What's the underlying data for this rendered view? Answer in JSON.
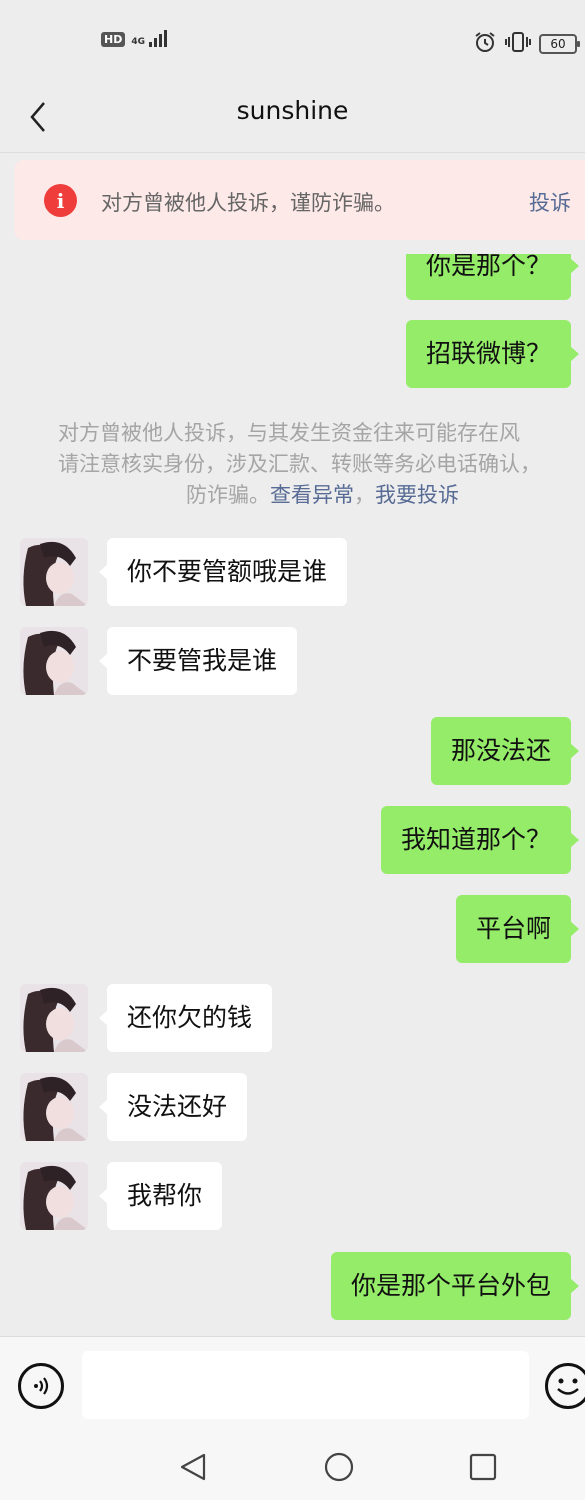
{
  "status_bar": {
    "hd_label": "HD",
    "network_label": "4G",
    "battery_level": "60"
  },
  "header": {
    "title": "sunshine"
  },
  "warning_banner": {
    "text": "对方曾被他人投诉，谨防诈骗。",
    "action_label": "投诉"
  },
  "messages": [
    {
      "direction": "out",
      "text": "你是那个？"
    },
    {
      "direction": "out",
      "text": "招联微博？"
    },
    {
      "direction": "in",
      "text": "你不要管额哦是谁"
    },
    {
      "direction": "in",
      "text": "不要管我是谁"
    },
    {
      "direction": "out",
      "text": "那没法还"
    },
    {
      "direction": "out",
      "text": "我知道那个？"
    },
    {
      "direction": "out",
      "text": "平台啊"
    },
    {
      "direction": "in",
      "text": "还你欠的钱"
    },
    {
      "direction": "in",
      "text": "没法还好"
    },
    {
      "direction": "in",
      "text": "我帮你"
    },
    {
      "direction": "out",
      "text": "你是那个平台外包"
    }
  ],
  "system_notice": {
    "line1": "对方曾被他人投诉，与其发生资金往来可能存在风",
    "line2": "请注意核实身份，涉及汇款、转账等务必电话确认，",
    "line3_prefix": "防诈骗。",
    "link_view": "查看异常",
    "separator": "，",
    "link_report": "我要投诉"
  },
  "input_bar": {
    "placeholder": ""
  },
  "colors": {
    "outgoing_bubble": "#95ec69",
    "incoming_bubble": "#ffffff",
    "warning_icon": "#ee3d3b",
    "link": "#576b95"
  },
  "icons": {
    "back": "chevron-left-icon",
    "warning": "info-icon",
    "voice": "voice-icon",
    "emoji": "emoji-icon",
    "alarm": "alarm-icon",
    "vibrate": "vibrate-icon",
    "nav_back": "triangle-back-icon",
    "nav_home": "circle-home-icon",
    "nav_recent": "square-recent-icon"
  }
}
